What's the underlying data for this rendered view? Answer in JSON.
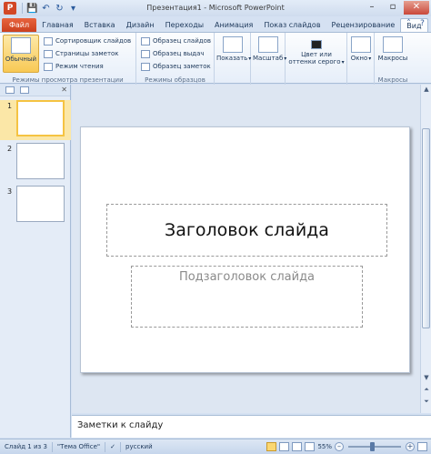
{
  "window": {
    "title": "Презентация1 - Microsoft PowerPoint",
    "app_icon": "P"
  },
  "qat": {
    "save": "💾",
    "undo": "↶",
    "redo": "↻",
    "customize": "▾"
  },
  "tabs": [
    {
      "label": "Файл"
    },
    {
      "label": "Главная"
    },
    {
      "label": "Вставка"
    },
    {
      "label": "Дизайн"
    },
    {
      "label": "Переходы"
    },
    {
      "label": "Анимация"
    },
    {
      "label": "Показ слайдов"
    },
    {
      "label": "Рецензирование"
    },
    {
      "label": "Вид"
    }
  ],
  "ribbon": {
    "presentation_views": {
      "label": "Режимы просмотра презентации",
      "normal": "Обычный",
      "slide_sorter": "Сортировщик слайдов",
      "notes_page": "Страницы заметок",
      "reading_view": "Режим чтения"
    },
    "master_views": {
      "label": "Режимы образцов",
      "slide_master": "Образец слайдов",
      "handout_master": "Образец выдач",
      "notes_master": "Образец заметок"
    },
    "show": {
      "label": "Показать"
    },
    "zoom": {
      "label": "Масштаб"
    },
    "color": {
      "label_line1": "Цвет или",
      "label_line2": "оттенки серого"
    },
    "window": {
      "label": "Окно"
    },
    "macros": {
      "button": "Макросы",
      "group_label": "Макросы"
    }
  },
  "thumbnails": [
    {
      "number": "1"
    },
    {
      "number": "2"
    },
    {
      "number": "3"
    }
  ],
  "slide": {
    "title_placeholder": "Заголовок слайда",
    "subtitle_placeholder": "Подзаголовок слайда"
  },
  "notes": {
    "placeholder": "Заметки к слайду"
  },
  "statusbar": {
    "slide_info": "Слайд 1 из 3",
    "theme": "\"Тема Office\"",
    "language": "русский",
    "zoom_percent": "55%"
  }
}
